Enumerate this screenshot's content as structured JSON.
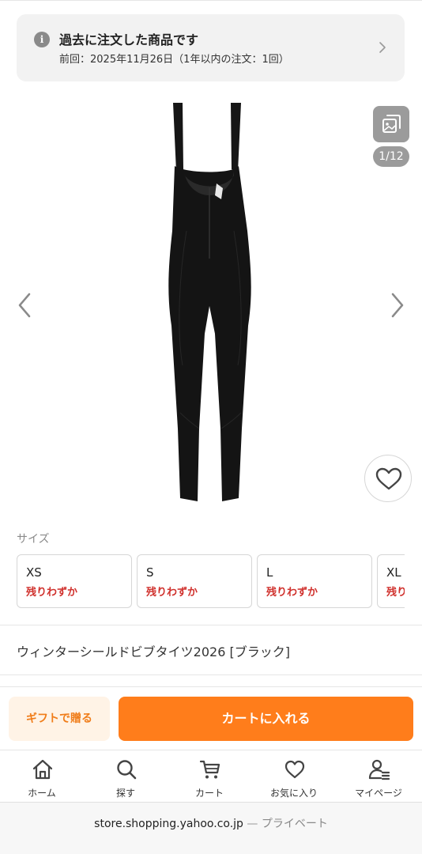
{
  "notice": {
    "title": "過去に注文した商品です",
    "subtitle": "前回：2025年11月26日（1年以内の注文：1回）",
    "icon": "info-icon"
  },
  "gallery": {
    "counter": "1/12",
    "product_image": "black-bib-tights",
    "icons": [
      "chevron-left-icon",
      "chevron-right-icon",
      "image-gallery-icon",
      "heart-icon"
    ]
  },
  "sizes": {
    "label": "サイズ",
    "options": [
      {
        "name": "XS",
        "stock": "残りわずか"
      },
      {
        "name": "S",
        "stock": "残りわずか"
      },
      {
        "name": "L",
        "stock": "残りわずか"
      },
      {
        "name": "XL",
        "stock": "残りわずか"
      }
    ]
  },
  "product": {
    "name": "ウィンターシールドビブタイツ2026 [ブラック]"
  },
  "actions": {
    "gift_label": "ギフトで贈る",
    "cart_label": "カートに入れる"
  },
  "tabbar": {
    "items": [
      {
        "label": "ホーム",
        "icon": "home-icon"
      },
      {
        "label": "探す",
        "icon": "search-icon"
      },
      {
        "label": "カート",
        "icon": "cart-icon"
      },
      {
        "label": "お気に入り",
        "icon": "heart-icon"
      },
      {
        "label": "マイページ",
        "icon": "user-icon"
      }
    ]
  },
  "browser": {
    "domain": "store.shopping.yahoo.co.jp",
    "separator": "—",
    "mode": "プライベート"
  },
  "colors": {
    "accent": "#ff7d1b",
    "stock_warning": "#d0312d",
    "gift_bg": "#fff3e6"
  }
}
